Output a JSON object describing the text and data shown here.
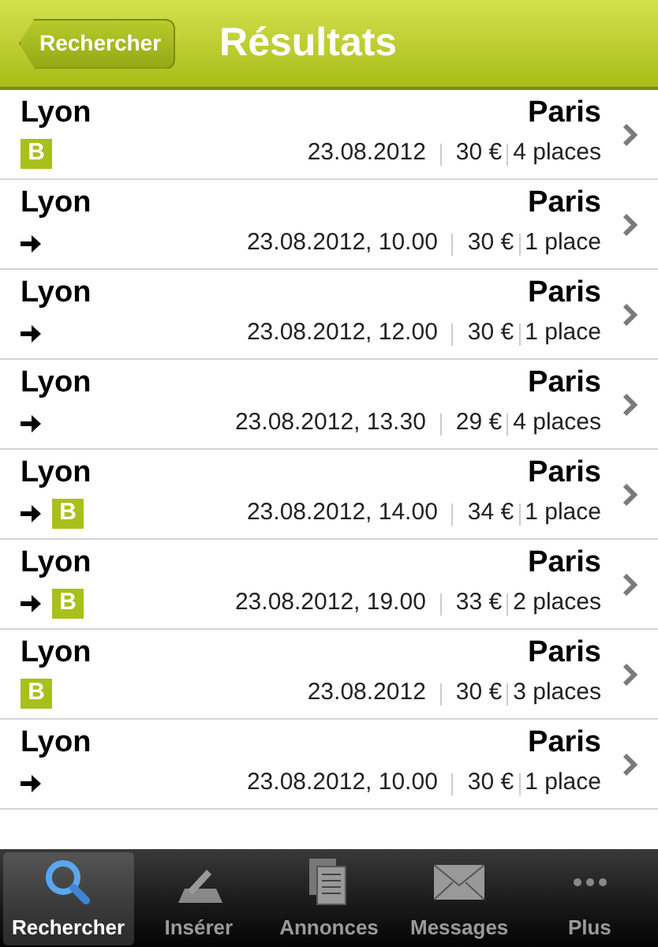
{
  "nav_bar": {
    "back_button": "Rechercher",
    "title": "Résultats"
  },
  "results": [
    {
      "from": "Lyon",
      "to": "Paris",
      "direct": false,
      "badge": "B",
      "date": "23.08.2012",
      "price": "30 €",
      "seats": "4 places"
    },
    {
      "from": "Lyon",
      "to": "Paris",
      "direct": true,
      "date": "23.08.2012, 10.00",
      "price": "30 €",
      "seats": "1 place"
    },
    {
      "from": "Lyon",
      "to": "Paris",
      "direct": true,
      "date": "23.08.2012, 12.00",
      "price": "30 €",
      "seats": "1 place"
    },
    {
      "from": "Lyon",
      "to": "Paris",
      "direct": true,
      "date": "23.08.2012, 13.30",
      "price": "29 €",
      "seats": "4 places"
    },
    {
      "from": "Lyon",
      "to": "Paris",
      "direct": true,
      "badge": "B",
      "date": "23.08.2012, 14.00",
      "price": "34 €",
      "seats": "1 place"
    },
    {
      "from": "Lyon",
      "to": "Paris",
      "direct": true,
      "badge": "B",
      "date": "23.08.2012, 19.00",
      "price": "33 €",
      "seats": "2 places"
    },
    {
      "from": "Lyon",
      "to": "Paris",
      "direct": false,
      "badge": "B",
      "date": "23.08.2012",
      "price": "30 €",
      "seats": "3 places"
    },
    {
      "from": "Lyon",
      "to": "Paris",
      "direct": true,
      "date": "23.08.2012, 10.00",
      "price": "30 €",
      "seats": "1 place"
    }
  ],
  "tab_bar": [
    {
      "label": "Rechercher",
      "selected": true
    },
    {
      "label": "Insérer",
      "selected": false
    },
    {
      "label": "Annonces",
      "selected": false
    },
    {
      "label": "Messages",
      "selected": false
    },
    {
      "label": "Plus",
      "selected": false
    }
  ]
}
